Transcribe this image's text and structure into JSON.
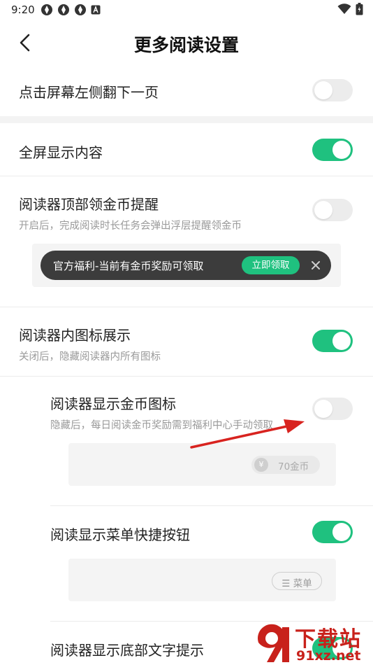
{
  "status_bar": {
    "time": "9:20",
    "left_icons": [
      "sync-icon",
      "sync-icon",
      "sync-icon",
      "notification-a-icon"
    ],
    "right_icons": [
      "wifi-icon",
      "battery-icon"
    ]
  },
  "header": {
    "title": "更多阅读设置",
    "back_icon": "chevron-left-icon"
  },
  "settings": [
    {
      "label": "点击屏幕左侧翻下一页",
      "enabled": false
    },
    {
      "label": "全屏显示内容",
      "enabled": true
    },
    {
      "label": "阅读器顶部领金币提醒",
      "description": "开启后，完成阅读时长任务会弹出浮层提醒领金币",
      "enabled": false
    },
    {
      "label": "阅读器内图标展示",
      "description": "关闭后，隐藏阅读器内所有图标",
      "enabled": true
    },
    {
      "label": "阅读器显示金币图标",
      "description": "隐藏后，每日阅读金币奖励需到福利中心手动领取",
      "enabled": false
    },
    {
      "label": "阅读显示菜单快捷按钮",
      "enabled": true
    },
    {
      "label": "阅读器显示底部文字提示",
      "enabled": true
    }
  ],
  "banner_preview": {
    "text": "官方福利-当前有金币奖励可领取",
    "button_label": "立即领取",
    "close_icon": "close-icon"
  },
  "coin_preview": {
    "coin_symbol": "¥",
    "text": "70金币"
  },
  "menu_preview": {
    "text": "☰ 菜单"
  },
  "watermark": {
    "title": "下载站",
    "url": "91xz.net"
  },
  "colors": {
    "accent": "#1fc17f",
    "toggle_off": "#ececec",
    "annotation_arrow": "#d8231f",
    "watermark": "#c8211b"
  }
}
